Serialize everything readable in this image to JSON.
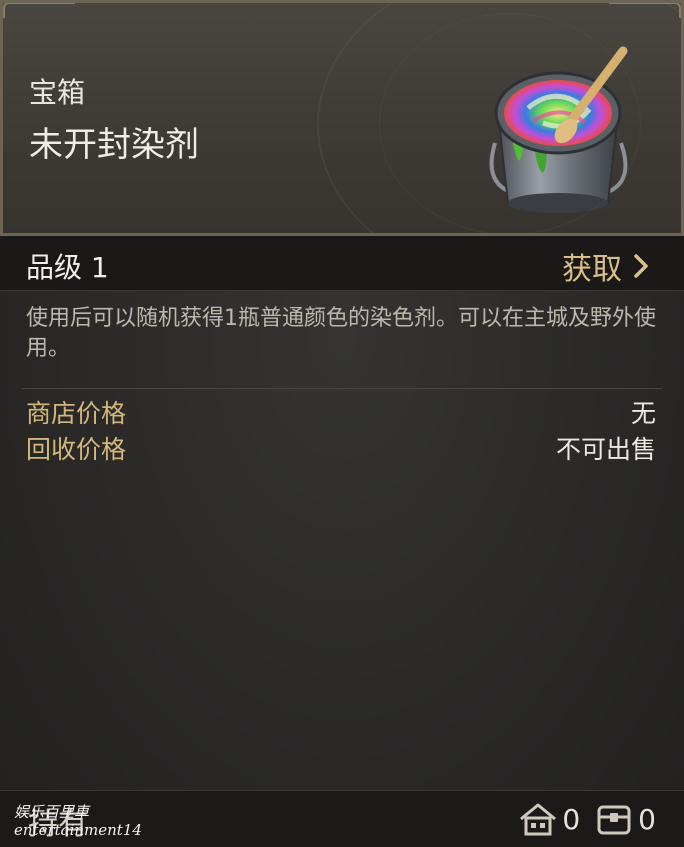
{
  "header": {
    "category": "宝箱",
    "item_name": "未开封染剂",
    "icon": "rainbow-paint-bucket-icon"
  },
  "grade_bar": {
    "grade": "品级 1",
    "obtain_label": "获取",
    "obtain_icon": "chevron-right-icon"
  },
  "description": "使用后可以随机获得1瓶普通颜色的染色剂。可以在主城及野外使用。",
  "prices": [
    {
      "label": "商店价格",
      "value": "无"
    },
    {
      "label": "回收价格",
      "value": "不可出售"
    }
  ],
  "footer": {
    "hold_label": "持有",
    "watermark_line1": "娱乐百里車",
    "watermark_line2": "entertainment14",
    "home_icon": "house-icon",
    "home_count": "0",
    "storage_icon": "chest-icon",
    "storage_count": "0"
  },
  "colors": {
    "accent_gold": "#d9c08a",
    "label_gold": "#d3b879",
    "frame": "#6d6452"
  }
}
